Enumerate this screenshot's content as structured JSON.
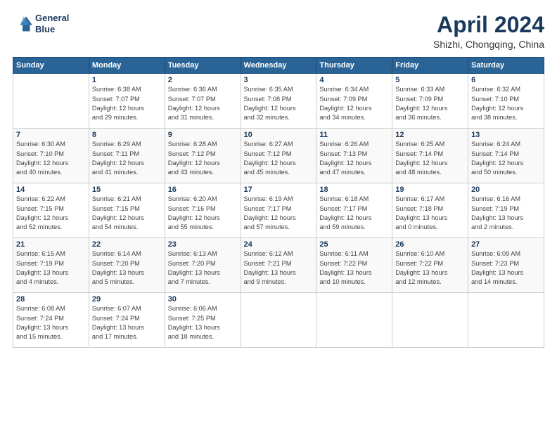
{
  "logo": {
    "line1": "General",
    "line2": "Blue"
  },
  "title": "April 2024",
  "location": "Shizhi, Chongqing, China",
  "weekdays": [
    "Sunday",
    "Monday",
    "Tuesday",
    "Wednesday",
    "Thursday",
    "Friday",
    "Saturday"
  ],
  "days": [
    {
      "date": null,
      "num": "",
      "sunrise": "",
      "sunset": "",
      "daylight": ""
    },
    {
      "date": 1,
      "num": "1",
      "sunrise": "6:38 AM",
      "sunset": "7:07 PM",
      "d1": "Daylight: 12 hours",
      "d2": "and 29 minutes."
    },
    {
      "date": 2,
      "num": "2",
      "sunrise": "6:36 AM",
      "sunset": "7:07 PM",
      "d1": "Daylight: 12 hours",
      "d2": "and 31 minutes."
    },
    {
      "date": 3,
      "num": "3",
      "sunrise": "6:35 AM",
      "sunset": "7:08 PM",
      "d1": "Daylight: 12 hours",
      "d2": "and 32 minutes."
    },
    {
      "date": 4,
      "num": "4",
      "sunrise": "6:34 AM",
      "sunset": "7:09 PM",
      "d1": "Daylight: 12 hours",
      "d2": "and 34 minutes."
    },
    {
      "date": 5,
      "num": "5",
      "sunrise": "6:33 AM",
      "sunset": "7:09 PM",
      "d1": "Daylight: 12 hours",
      "d2": "and 36 minutes."
    },
    {
      "date": 6,
      "num": "6",
      "sunrise": "6:32 AM",
      "sunset": "7:10 PM",
      "d1": "Daylight: 12 hours",
      "d2": "and 38 minutes."
    },
    {
      "date": 7,
      "num": "7",
      "sunrise": "6:30 AM",
      "sunset": "7:10 PM",
      "d1": "Daylight: 12 hours",
      "d2": "and 40 minutes."
    },
    {
      "date": 8,
      "num": "8",
      "sunrise": "6:29 AM",
      "sunset": "7:11 PM",
      "d1": "Daylight: 12 hours",
      "d2": "and 41 minutes."
    },
    {
      "date": 9,
      "num": "9",
      "sunrise": "6:28 AM",
      "sunset": "7:12 PM",
      "d1": "Daylight: 12 hours",
      "d2": "and 43 minutes."
    },
    {
      "date": 10,
      "num": "10",
      "sunrise": "6:27 AM",
      "sunset": "7:12 PM",
      "d1": "Daylight: 12 hours",
      "d2": "and 45 minutes."
    },
    {
      "date": 11,
      "num": "11",
      "sunrise": "6:26 AM",
      "sunset": "7:13 PM",
      "d1": "Daylight: 12 hours",
      "d2": "and 47 minutes."
    },
    {
      "date": 12,
      "num": "12",
      "sunrise": "6:25 AM",
      "sunset": "7:14 PM",
      "d1": "Daylight: 12 hours",
      "d2": "and 48 minutes."
    },
    {
      "date": 13,
      "num": "13",
      "sunrise": "6:24 AM",
      "sunset": "7:14 PM",
      "d1": "Daylight: 12 hours",
      "d2": "and 50 minutes."
    },
    {
      "date": 14,
      "num": "14",
      "sunrise": "6:22 AM",
      "sunset": "7:15 PM",
      "d1": "Daylight: 12 hours",
      "d2": "and 52 minutes."
    },
    {
      "date": 15,
      "num": "15",
      "sunrise": "6:21 AM",
      "sunset": "7:15 PM",
      "d1": "Daylight: 12 hours",
      "d2": "and 54 minutes."
    },
    {
      "date": 16,
      "num": "16",
      "sunrise": "6:20 AM",
      "sunset": "7:16 PM",
      "d1": "Daylight: 12 hours",
      "d2": "and 55 minutes."
    },
    {
      "date": 17,
      "num": "17",
      "sunrise": "6:19 AM",
      "sunset": "7:17 PM",
      "d1": "Daylight: 12 hours",
      "d2": "and 57 minutes."
    },
    {
      "date": 18,
      "num": "18",
      "sunrise": "6:18 AM",
      "sunset": "7:17 PM",
      "d1": "Daylight: 12 hours",
      "d2": "and 59 minutes."
    },
    {
      "date": 19,
      "num": "19",
      "sunrise": "6:17 AM",
      "sunset": "7:18 PM",
      "d1": "Daylight: 13 hours",
      "d2": "and 0 minutes."
    },
    {
      "date": 20,
      "num": "20",
      "sunrise": "6:16 AM",
      "sunset": "7:19 PM",
      "d1": "Daylight: 13 hours",
      "d2": "and 2 minutes."
    },
    {
      "date": 21,
      "num": "21",
      "sunrise": "6:15 AM",
      "sunset": "7:19 PM",
      "d1": "Daylight: 13 hours",
      "d2": "and 4 minutes."
    },
    {
      "date": 22,
      "num": "22",
      "sunrise": "6:14 AM",
      "sunset": "7:20 PM",
      "d1": "Daylight: 13 hours",
      "d2": "and 5 minutes."
    },
    {
      "date": 23,
      "num": "23",
      "sunrise": "6:13 AM",
      "sunset": "7:20 PM",
      "d1": "Daylight: 13 hours",
      "d2": "and 7 minutes."
    },
    {
      "date": 24,
      "num": "24",
      "sunrise": "6:12 AM",
      "sunset": "7:21 PM",
      "d1": "Daylight: 13 hours",
      "d2": "and 9 minutes."
    },
    {
      "date": 25,
      "num": "25",
      "sunrise": "6:11 AM",
      "sunset": "7:22 PM",
      "d1": "Daylight: 13 hours",
      "d2": "and 10 minutes."
    },
    {
      "date": 26,
      "num": "26",
      "sunrise": "6:10 AM",
      "sunset": "7:22 PM",
      "d1": "Daylight: 13 hours",
      "d2": "and 12 minutes."
    },
    {
      "date": 27,
      "num": "27",
      "sunrise": "6:09 AM",
      "sunset": "7:23 PM",
      "d1": "Daylight: 13 hours",
      "d2": "and 14 minutes."
    },
    {
      "date": 28,
      "num": "28",
      "sunrise": "6:08 AM",
      "sunset": "7:24 PM",
      "d1": "Daylight: 13 hours",
      "d2": "and 15 minutes."
    },
    {
      "date": 29,
      "num": "29",
      "sunrise": "6:07 AM",
      "sunset": "7:24 PM",
      "d1": "Daylight: 13 hours",
      "d2": "and 17 minutes."
    },
    {
      "date": 30,
      "num": "30",
      "sunrise": "6:06 AM",
      "sunset": "7:25 PM",
      "d1": "Daylight: 13 hours",
      "d2": "and 18 minutes."
    }
  ]
}
